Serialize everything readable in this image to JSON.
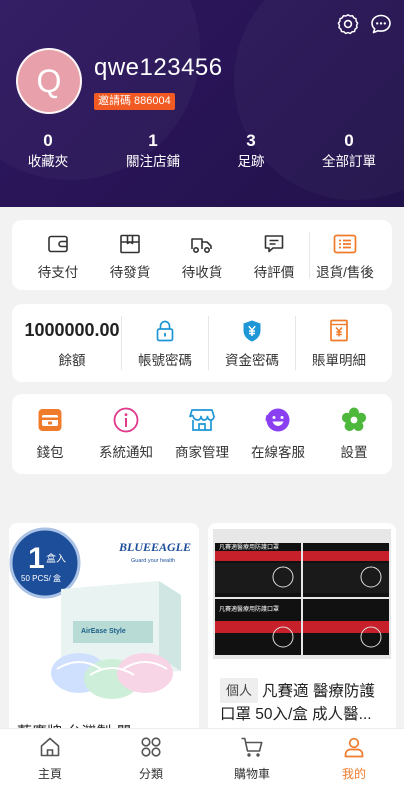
{
  "header": {
    "username": "qwe123456",
    "avatar_letter": "Q",
    "invite_code": "邀請碼 886004",
    "settings_icon": "gear-icon",
    "message_icon": "chat-bubble-icon",
    "stats": [
      {
        "value": "0",
        "label": "收藏夾"
      },
      {
        "value": "1",
        "label": "關注店鋪"
      },
      {
        "value": "3",
        "label": "足跡"
      },
      {
        "value": "0",
        "label": "全部訂單"
      }
    ]
  },
  "orders": {
    "items": [
      {
        "label": "待支付",
        "icon": "wallet-icon"
      },
      {
        "label": "待發貨",
        "icon": "box-icon"
      },
      {
        "label": "待收貨",
        "icon": "truck-icon"
      },
      {
        "label": "待評價",
        "icon": "comment-icon"
      },
      {
        "label": "退貨/售後",
        "icon": "return-list-icon"
      }
    ]
  },
  "account": {
    "balance_value": "1000000.00",
    "balance_label": "餘額",
    "items": [
      {
        "label": "帳號密碼",
        "icon": "lock-icon"
      },
      {
        "label": "資金密碼",
        "icon": "shield-yen-icon"
      },
      {
        "label": "賬單明細",
        "icon": "bill-yen-icon"
      }
    ]
  },
  "services": {
    "items": [
      {
        "label": "錢包",
        "icon": "wallet-card-icon"
      },
      {
        "label": "系統通知",
        "icon": "info-icon"
      },
      {
        "label": "商家管理",
        "icon": "shop-icon"
      },
      {
        "label": "在線客服",
        "icon": "smiley-headset-icon"
      },
      {
        "label": "設置",
        "icon": "flower-gear-icon"
      }
    ]
  },
  "products": [
    {
      "brand": "BLUEEAGLE",
      "brand_tagline": "Guard your health",
      "badge_big": "1",
      "badge_unit": "盒入",
      "badge_sub": "50 PCS/ 盒",
      "box_text": "AirEase Style",
      "title_partial": "藍鷹牌 台灣製 嬰"
    },
    {
      "tag": "個人",
      "title": "凡賽適 醫療防護口罩 50入/盒 成人醫...",
      "box_label": "凡賽適醫療用防護口罩"
    }
  ],
  "tabbar": {
    "items": [
      {
        "label": "主頁",
        "icon": "home-icon"
      },
      {
        "label": "分類",
        "icon": "category-icon"
      },
      {
        "label": "購物車",
        "icon": "cart-icon"
      },
      {
        "label": "我的",
        "icon": "user-icon"
      }
    ],
    "active_color": "#f07b2b"
  },
  "colors": {
    "header_bg": "#2a1659",
    "invite_bg": "#f15a22",
    "accent": "#f07b2b"
  }
}
